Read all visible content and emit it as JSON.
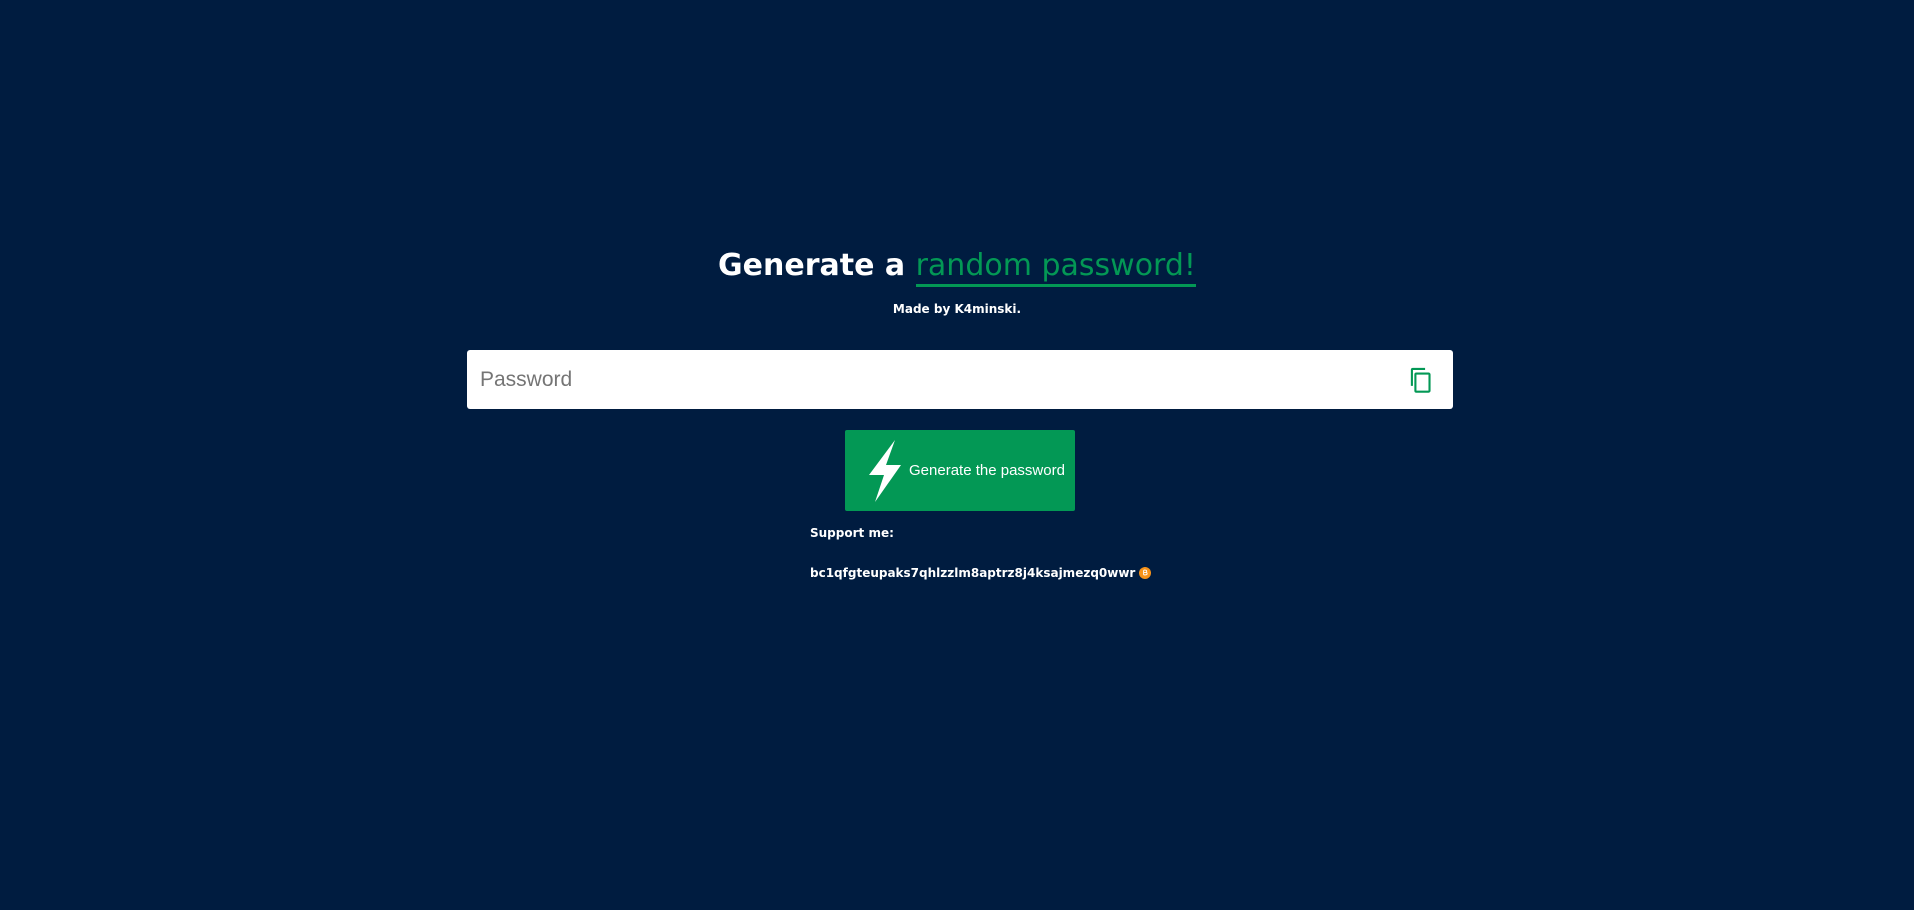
{
  "header": {
    "title_prefix": "Generate a ",
    "title_accent": "random password!",
    "subtitle": "Made by K4minski."
  },
  "password": {
    "placeholder": "Password",
    "value": ""
  },
  "actions": {
    "generate_label": "Generate the password"
  },
  "support": {
    "label": "Support me:",
    "btc_address": "bc1qfgteupaks7qhlzzlm8aptrz8j4ksajmezq0wwr"
  },
  "icons": {
    "copy": "copy-icon",
    "generate": "lightning-bolt-icon",
    "bitcoin": "bitcoin-icon"
  },
  "colors": {
    "background": "#001c40",
    "accent": "#039855",
    "text": "#ffffff",
    "bitcoin": "#f7931a"
  }
}
